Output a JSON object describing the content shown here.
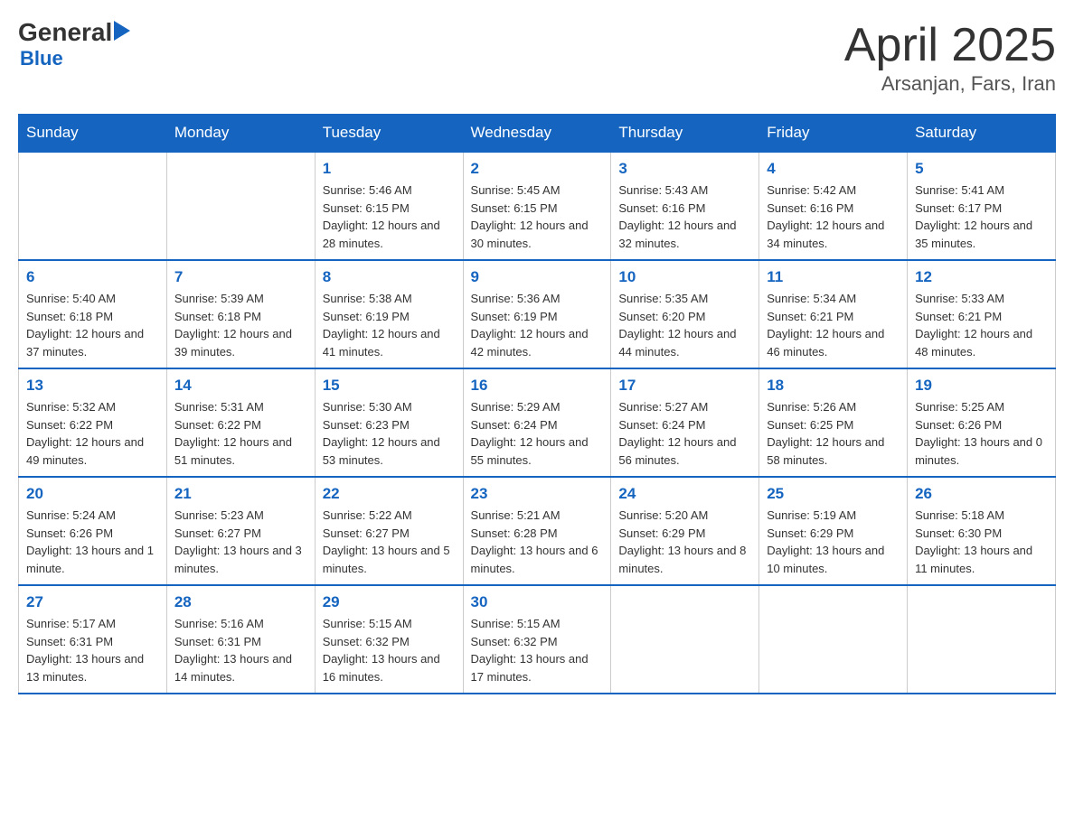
{
  "logo": {
    "general": "General",
    "arrow": "▶",
    "blue": "Blue"
  },
  "title": "April 2025",
  "subtitle": "Arsanjan, Fars, Iran",
  "days_of_week": [
    "Sunday",
    "Monday",
    "Tuesday",
    "Wednesday",
    "Thursday",
    "Friday",
    "Saturday"
  ],
  "weeks": [
    [
      {
        "day": "",
        "sunrise": "",
        "sunset": "",
        "daylight": ""
      },
      {
        "day": "",
        "sunrise": "",
        "sunset": "",
        "daylight": ""
      },
      {
        "day": "1",
        "sunrise": "Sunrise: 5:46 AM",
        "sunset": "Sunset: 6:15 PM",
        "daylight": "Daylight: 12 hours and 28 minutes."
      },
      {
        "day": "2",
        "sunrise": "Sunrise: 5:45 AM",
        "sunset": "Sunset: 6:15 PM",
        "daylight": "Daylight: 12 hours and 30 minutes."
      },
      {
        "day": "3",
        "sunrise": "Sunrise: 5:43 AM",
        "sunset": "Sunset: 6:16 PM",
        "daylight": "Daylight: 12 hours and 32 minutes."
      },
      {
        "day": "4",
        "sunrise": "Sunrise: 5:42 AM",
        "sunset": "Sunset: 6:16 PM",
        "daylight": "Daylight: 12 hours and 34 minutes."
      },
      {
        "day": "5",
        "sunrise": "Sunrise: 5:41 AM",
        "sunset": "Sunset: 6:17 PM",
        "daylight": "Daylight: 12 hours and 35 minutes."
      }
    ],
    [
      {
        "day": "6",
        "sunrise": "Sunrise: 5:40 AM",
        "sunset": "Sunset: 6:18 PM",
        "daylight": "Daylight: 12 hours and 37 minutes."
      },
      {
        "day": "7",
        "sunrise": "Sunrise: 5:39 AM",
        "sunset": "Sunset: 6:18 PM",
        "daylight": "Daylight: 12 hours and 39 minutes."
      },
      {
        "day": "8",
        "sunrise": "Sunrise: 5:38 AM",
        "sunset": "Sunset: 6:19 PM",
        "daylight": "Daylight: 12 hours and 41 minutes."
      },
      {
        "day": "9",
        "sunrise": "Sunrise: 5:36 AM",
        "sunset": "Sunset: 6:19 PM",
        "daylight": "Daylight: 12 hours and 42 minutes."
      },
      {
        "day": "10",
        "sunrise": "Sunrise: 5:35 AM",
        "sunset": "Sunset: 6:20 PM",
        "daylight": "Daylight: 12 hours and 44 minutes."
      },
      {
        "day": "11",
        "sunrise": "Sunrise: 5:34 AM",
        "sunset": "Sunset: 6:21 PM",
        "daylight": "Daylight: 12 hours and 46 minutes."
      },
      {
        "day": "12",
        "sunrise": "Sunrise: 5:33 AM",
        "sunset": "Sunset: 6:21 PM",
        "daylight": "Daylight: 12 hours and 48 minutes."
      }
    ],
    [
      {
        "day": "13",
        "sunrise": "Sunrise: 5:32 AM",
        "sunset": "Sunset: 6:22 PM",
        "daylight": "Daylight: 12 hours and 49 minutes."
      },
      {
        "day": "14",
        "sunrise": "Sunrise: 5:31 AM",
        "sunset": "Sunset: 6:22 PM",
        "daylight": "Daylight: 12 hours and 51 minutes."
      },
      {
        "day": "15",
        "sunrise": "Sunrise: 5:30 AM",
        "sunset": "Sunset: 6:23 PM",
        "daylight": "Daylight: 12 hours and 53 minutes."
      },
      {
        "day": "16",
        "sunrise": "Sunrise: 5:29 AM",
        "sunset": "Sunset: 6:24 PM",
        "daylight": "Daylight: 12 hours and 55 minutes."
      },
      {
        "day": "17",
        "sunrise": "Sunrise: 5:27 AM",
        "sunset": "Sunset: 6:24 PM",
        "daylight": "Daylight: 12 hours and 56 minutes."
      },
      {
        "day": "18",
        "sunrise": "Sunrise: 5:26 AM",
        "sunset": "Sunset: 6:25 PM",
        "daylight": "Daylight: 12 hours and 58 minutes."
      },
      {
        "day": "19",
        "sunrise": "Sunrise: 5:25 AM",
        "sunset": "Sunset: 6:26 PM",
        "daylight": "Daylight: 13 hours and 0 minutes."
      }
    ],
    [
      {
        "day": "20",
        "sunrise": "Sunrise: 5:24 AM",
        "sunset": "Sunset: 6:26 PM",
        "daylight": "Daylight: 13 hours and 1 minute."
      },
      {
        "day": "21",
        "sunrise": "Sunrise: 5:23 AM",
        "sunset": "Sunset: 6:27 PM",
        "daylight": "Daylight: 13 hours and 3 minutes."
      },
      {
        "day": "22",
        "sunrise": "Sunrise: 5:22 AM",
        "sunset": "Sunset: 6:27 PM",
        "daylight": "Daylight: 13 hours and 5 minutes."
      },
      {
        "day": "23",
        "sunrise": "Sunrise: 5:21 AM",
        "sunset": "Sunset: 6:28 PM",
        "daylight": "Daylight: 13 hours and 6 minutes."
      },
      {
        "day": "24",
        "sunrise": "Sunrise: 5:20 AM",
        "sunset": "Sunset: 6:29 PM",
        "daylight": "Daylight: 13 hours and 8 minutes."
      },
      {
        "day": "25",
        "sunrise": "Sunrise: 5:19 AM",
        "sunset": "Sunset: 6:29 PM",
        "daylight": "Daylight: 13 hours and 10 minutes."
      },
      {
        "day": "26",
        "sunrise": "Sunrise: 5:18 AM",
        "sunset": "Sunset: 6:30 PM",
        "daylight": "Daylight: 13 hours and 11 minutes."
      }
    ],
    [
      {
        "day": "27",
        "sunrise": "Sunrise: 5:17 AM",
        "sunset": "Sunset: 6:31 PM",
        "daylight": "Daylight: 13 hours and 13 minutes."
      },
      {
        "day": "28",
        "sunrise": "Sunrise: 5:16 AM",
        "sunset": "Sunset: 6:31 PM",
        "daylight": "Daylight: 13 hours and 14 minutes."
      },
      {
        "day": "29",
        "sunrise": "Sunrise: 5:15 AM",
        "sunset": "Sunset: 6:32 PM",
        "daylight": "Daylight: 13 hours and 16 minutes."
      },
      {
        "day": "30",
        "sunrise": "Sunrise: 5:15 AM",
        "sunset": "Sunset: 6:32 PM",
        "daylight": "Daylight: 13 hours and 17 minutes."
      },
      {
        "day": "",
        "sunrise": "",
        "sunset": "",
        "daylight": ""
      },
      {
        "day": "",
        "sunrise": "",
        "sunset": "",
        "daylight": ""
      },
      {
        "day": "",
        "sunrise": "",
        "sunset": "",
        "daylight": ""
      }
    ]
  ]
}
